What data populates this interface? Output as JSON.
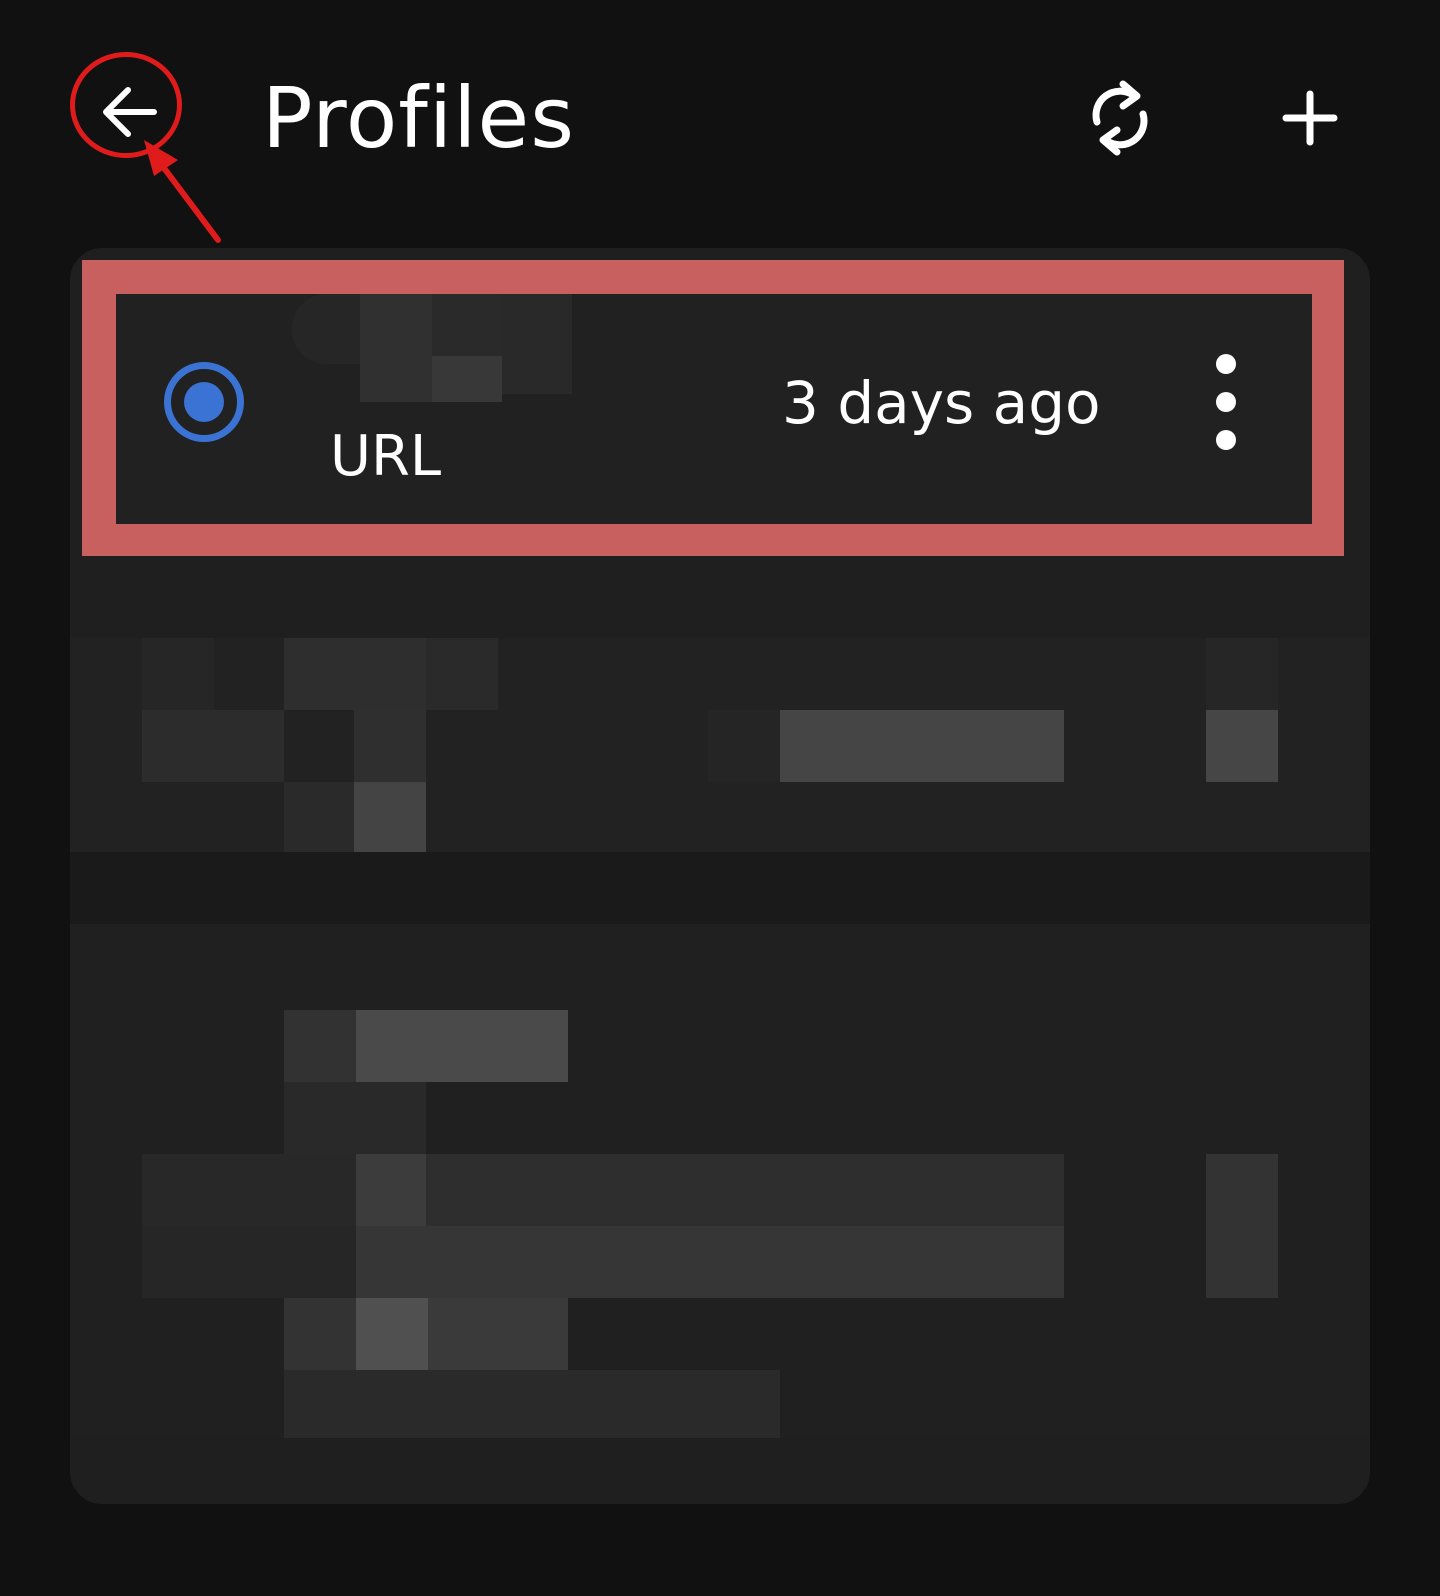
{
  "app_bar": {
    "title": "Profiles",
    "back_icon": "arrow-left-icon",
    "sync_icon": "sync-icon",
    "add_icon": "plus-icon"
  },
  "profiles": [
    {
      "type": "URL",
      "updated": "3 days ago",
      "selected": true
    }
  ],
  "colors": {
    "background": "#111111",
    "card": "#1f1f1f",
    "radio_accent": "#3a73d4",
    "annotation_red": "#e01b1b",
    "highlight_frame": "#c86060"
  }
}
